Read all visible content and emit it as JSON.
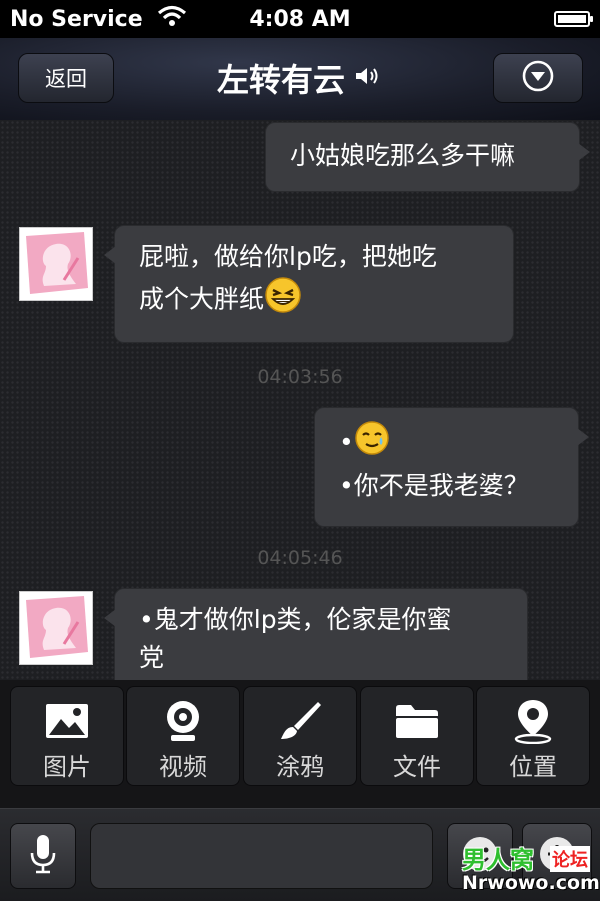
{
  "status_bar": {
    "carrier": "No Service",
    "time": "4:08 AM",
    "battery_level": 0.85
  },
  "nav": {
    "back_label": "返回",
    "title": "左转有云"
  },
  "messages": [
    {
      "side": "right",
      "text": "小姑娘吃那么多干嘛"
    },
    {
      "side": "left",
      "line1": "屁啦，做给你lp吃，把她吃",
      "line2": "成个大胖纸"
    },
    {
      "side": "right",
      "line1": "•",
      "line2": "•你不是我老婆？"
    },
    {
      "side": "left",
      "line1": "•鬼才做你lp类，伦家是你蜜",
      "line2": "党"
    }
  ],
  "timestamps": [
    "04:03:56",
    "04:05:46"
  ],
  "toolbar": {
    "items": [
      {
        "label": "图片",
        "icon": "image-icon"
      },
      {
        "label": "视频",
        "icon": "webcam-icon"
      },
      {
        "label": "涂鸦",
        "icon": "brush-icon"
      },
      {
        "label": "文件",
        "icon": "folder-icon"
      },
      {
        "label": "位置",
        "icon": "location-pin-icon"
      }
    ]
  },
  "input": {
    "placeholder": ""
  },
  "watermark": {
    "line1": "男人窝",
    "badge": "论坛",
    "line2": "Nrwowo.com"
  },
  "colors": {
    "bubble": "#3b3c40",
    "nav": "#1a1d29",
    "timestamp": "#555555"
  }
}
